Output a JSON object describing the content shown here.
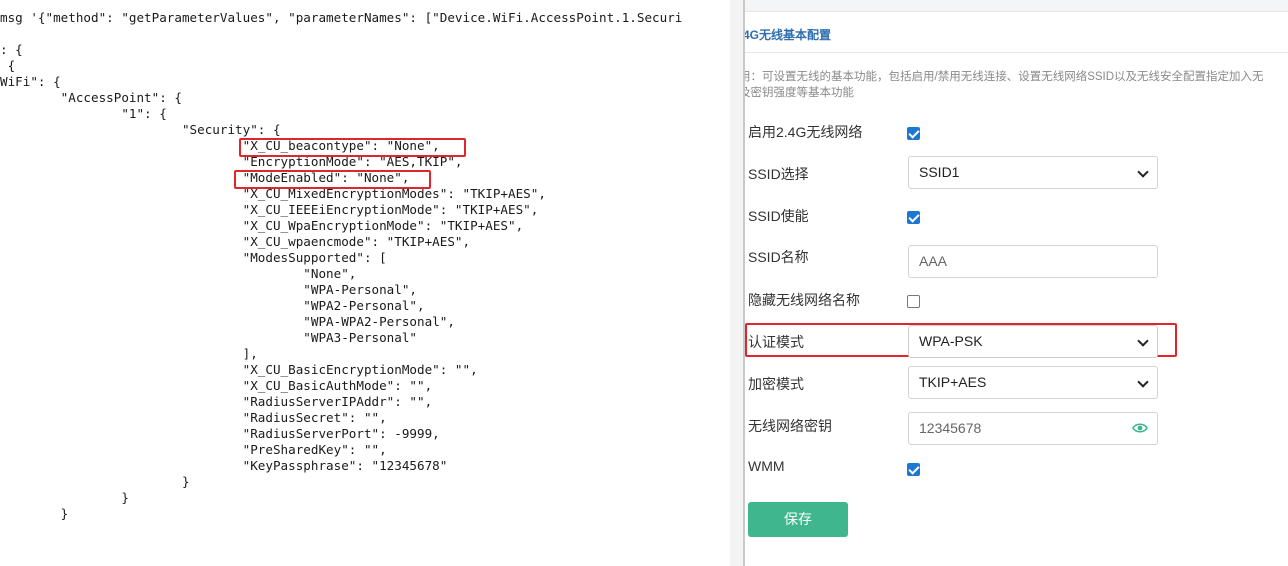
{
  "code": {
    "lines": [
      "msg '{\"method\": \"getParameterValues\", \"parameterNames\": [\"Device.WiFi.AccessPoint.1.Securi",
      "",
      ": {",
      " {",
      "WiFi\": {",
      "        \"AccessPoint\": {",
      "                \"1\": {",
      "                        \"Security\": {",
      "                                \"X_CU_beacontype\": \"None\",",
      "                                \"EncryptionMode\": \"AES,TKIP\",",
      "                                \"ModeEnabled\": \"None\",",
      "                                \"X_CU_MixedEncryptionModes\": \"TKIP+AES\",",
      "                                \"X_CU_IEEEiEncryptionMode\": \"TKIP+AES\",",
      "                                \"X_CU_WpaEncryptionMode\": \"TKIP+AES\",",
      "                                \"X_CU_wpaencmode\": \"TKIP+AES\",",
      "                                \"ModesSupported\": [",
      "                                        \"None\",",
      "                                        \"WPA-Personal\",",
      "                                        \"WPA2-Personal\",",
      "                                        \"WPA-WPA2-Personal\",",
      "                                        \"WPA3-Personal\"",
      "                                ],",
      "                                \"X_CU_BasicEncryptionMode\": \"\",",
      "                                \"X_CU_BasicAuthMode\": \"\",",
      "                                \"RadiusServerIPAddr\": \"\",",
      "                                \"RadiusSecret\": \"\",",
      "                                \"RadiusServerPort\": -9999,",
      "                                \"PreSharedKey\": \"\",",
      "                                \"KeyPassphrase\": \"12345678\"",
      "                        }",
      "                }",
      "        }"
    ]
  },
  "config": {
    "section_title": "4G无线基本配置",
    "hint_line1": "用：可设置无线的基本功能，包括启用/禁用无线连接、设置无线网络SSID以及无线安全配置指定加入无",
    "hint_line2": "及密钥强度等基本功能",
    "enable_label": "启用2.4G无线网络",
    "ssid_select_label": "SSID选择",
    "ssid_select_value": "SSID1",
    "ssid_enable_label": "SSID使能",
    "ssid_name_label": "SSID名称",
    "ssid_name_value": "AAA",
    "hide_ssid_label": "隐藏无线网络名称",
    "auth_mode_label": "认证模式",
    "auth_mode_value": "WPA-PSK",
    "encryption_label": "加密模式",
    "encryption_value": "TKIP+AES",
    "key_label": "无线网络密钥",
    "key_value": "12345678",
    "wmm_label": "WMM",
    "save_label": "保存",
    "checkbox_states": {
      "enable_24g": true,
      "ssid_enable": true,
      "hide_ssid": false,
      "wmm": true
    },
    "colors": {
      "accent": "#1e77d2",
      "save_button": "#3fb68e",
      "highlight": "#e0262b",
      "eye_icon": "#3fb68e"
    }
  }
}
